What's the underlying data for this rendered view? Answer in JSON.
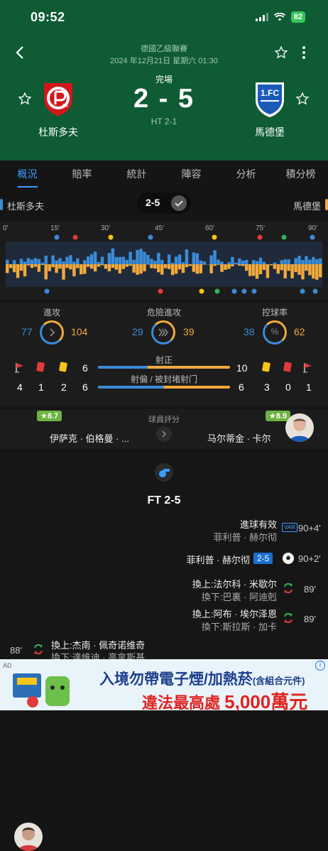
{
  "status_bar": {
    "time": "09:52",
    "battery": "82"
  },
  "header": {
    "league": "德國乙級聯賽",
    "datetime": "2024 年12月21日 星期六 01:30",
    "status": "完場",
    "score": "2 - 5",
    "halftime": "HT 2-1",
    "home": {
      "name": "杜斯多夫",
      "logo_text": "95"
    },
    "away": {
      "name": "馬德堡",
      "logo_text": "1.FC"
    }
  },
  "tabs": [
    "概況",
    "賠率",
    "統計",
    "陣容",
    "分析",
    "積分榜"
  ],
  "teambar": {
    "home": "杜斯多夫",
    "away": "馬德堡",
    "score": "2-5"
  },
  "timeline": {
    "ticks": [
      "0'",
      "15'",
      "30'",
      "45'",
      "60'",
      "75'",
      "90'"
    ]
  },
  "stats": {
    "attack": {
      "label": "進攻",
      "home": "77",
      "away": "104"
    },
    "dangerous": {
      "label": "危險進攻",
      "home": "29",
      "away": "39"
    },
    "possession": {
      "label": "控球率",
      "home": "38",
      "away": "62",
      "symbol": "%"
    },
    "home_row1": {
      "corners": "",
      "red": "",
      "yellow": "",
      "shots_on": "6"
    },
    "away_row1": {
      "shots_on": "10"
    },
    "shots_on_label": "射正",
    "shots_off_label": "射偏 / 被封堵射门",
    "home_row2": {
      "corners": "4",
      "red": "1",
      "yellow": "2",
      "shots_off": "6"
    },
    "away_row2": {
      "shots_off": "6",
      "yellow": "3",
      "red": "0",
      "corners": "1"
    },
    "shots_on_share": 0.375,
    "shots_off_share": 0.5
  },
  "ratings": {
    "label": "球員評分",
    "home": {
      "rating": "★8.7",
      "name": "伊萨克 · 伯格曼 · ..."
    },
    "away": {
      "rating": "★8.9",
      "name": "马尔蒂金 · 卡尔"
    }
  },
  "events": {
    "ft": "FT 2-5",
    "e1": {
      "main": "進球有效",
      "sub": "菲利普 · 赫尔彻",
      "badge": "VAR",
      "min": "90+4'"
    },
    "e2": {
      "main": "菲利普 · 赫尔彻",
      "badge": "2-5",
      "min": "90+2'"
    },
    "e3": {
      "main": "換上:法尔科 · 米歇尔",
      "sub": "換下:巴裏 · 阿迪剋",
      "min": "89'"
    },
    "e4": {
      "main": "換上:阿布 · 埃尔泽恩",
      "sub": "換下:斯拉斯 · 加卡",
      "min": "89'"
    },
    "e5": {
      "main": "換上:杰南 · 佩奇诺维奇",
      "sub": "換下:達維迪 · 高拿斯基",
      "min": "88'"
    }
  },
  "ad": {
    "tag": "AD",
    "line1": "入境勿帶電子煙/加熱菸",
    "line1_small": "(含組合元件)",
    "line2": "違法最高處",
    "amount": "5,000萬元"
  },
  "colors": {
    "header_green": "#0e5b34",
    "home_blue": "#3b8bd8",
    "away_orange": "#f2a93b",
    "accent": "#3b9cff"
  }
}
